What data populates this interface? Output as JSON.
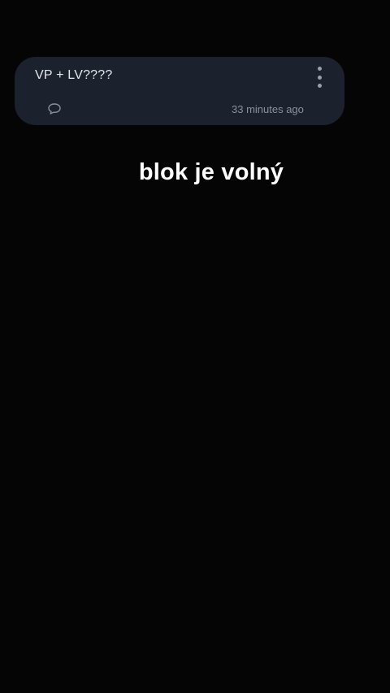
{
  "post": {
    "title": "VP + LV????",
    "timestamp": "33 minutes ago",
    "more_icon": "more-vertical-icon",
    "comment_icon": "comment-bubble-icon"
  },
  "overlay": {
    "caption": "blok je volný"
  },
  "colors": {
    "background": "#050505",
    "card": "#1c222d",
    "title_text": "#e3e6ec",
    "meta_text": "#8a909b",
    "caption_text": "#ffffff"
  }
}
